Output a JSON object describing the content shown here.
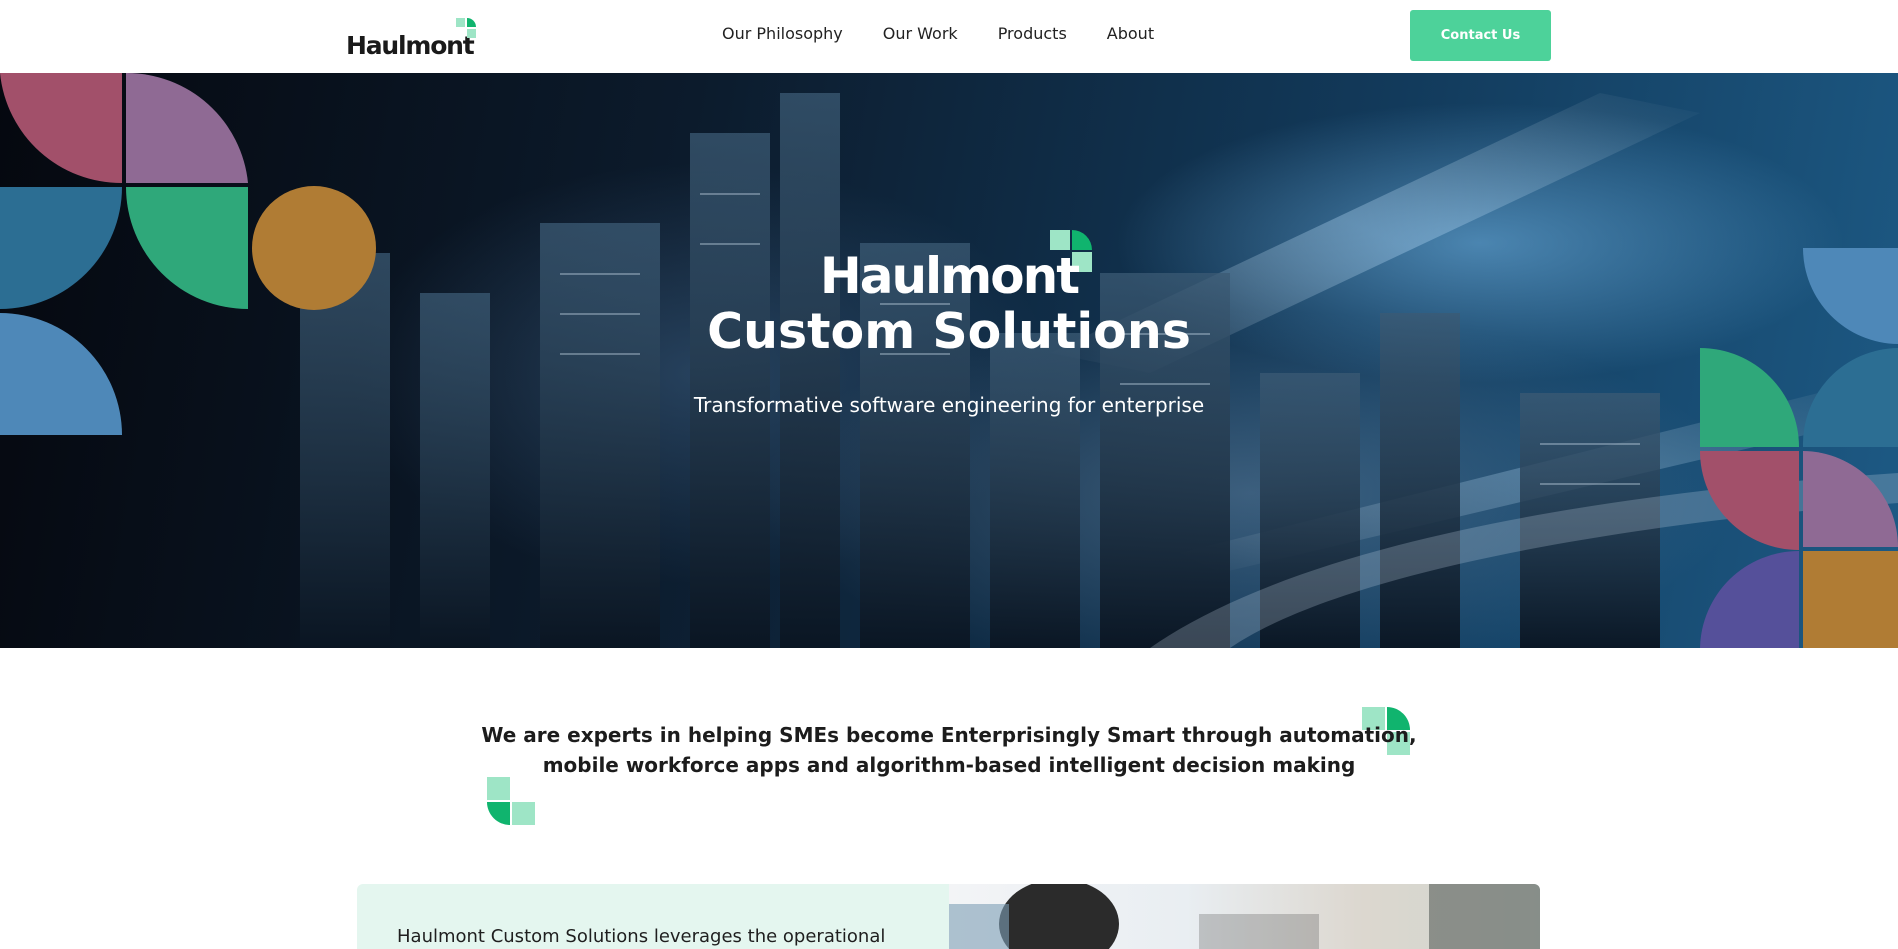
{
  "header": {
    "logo_text": "Haulmont",
    "nav": [
      "Our Philosophy",
      "Our Work",
      "Products",
      "About"
    ],
    "contact_label": "Contact Us"
  },
  "hero": {
    "title_line1": "Haulmont",
    "title_line2": "Custom Solutions",
    "subtitle": "Transformative software engineering for enterprise"
  },
  "intro": {
    "line1": "We are experts in helping SMEs become Enterprisingly Smart through automation,",
    "line2": "mobile workforce apps and algorithm-based intelligent decision making"
  },
  "feature": {
    "text": "Haulmont Custom Solutions leverages the operational"
  },
  "colors": {
    "accent_green": "#4dd29a",
    "mark_light": "#9ee5c6",
    "mark_dark": "#10b46e",
    "deco_pink": "#a2506a",
    "deco_purple": "#8f6a94",
    "deco_teal": "#2c6e93",
    "deco_green": "#2fa87a",
    "deco_orange": "#b07c34",
    "deco_blue": "#4e88b8",
    "feature_bg": "#e4f6ef"
  }
}
